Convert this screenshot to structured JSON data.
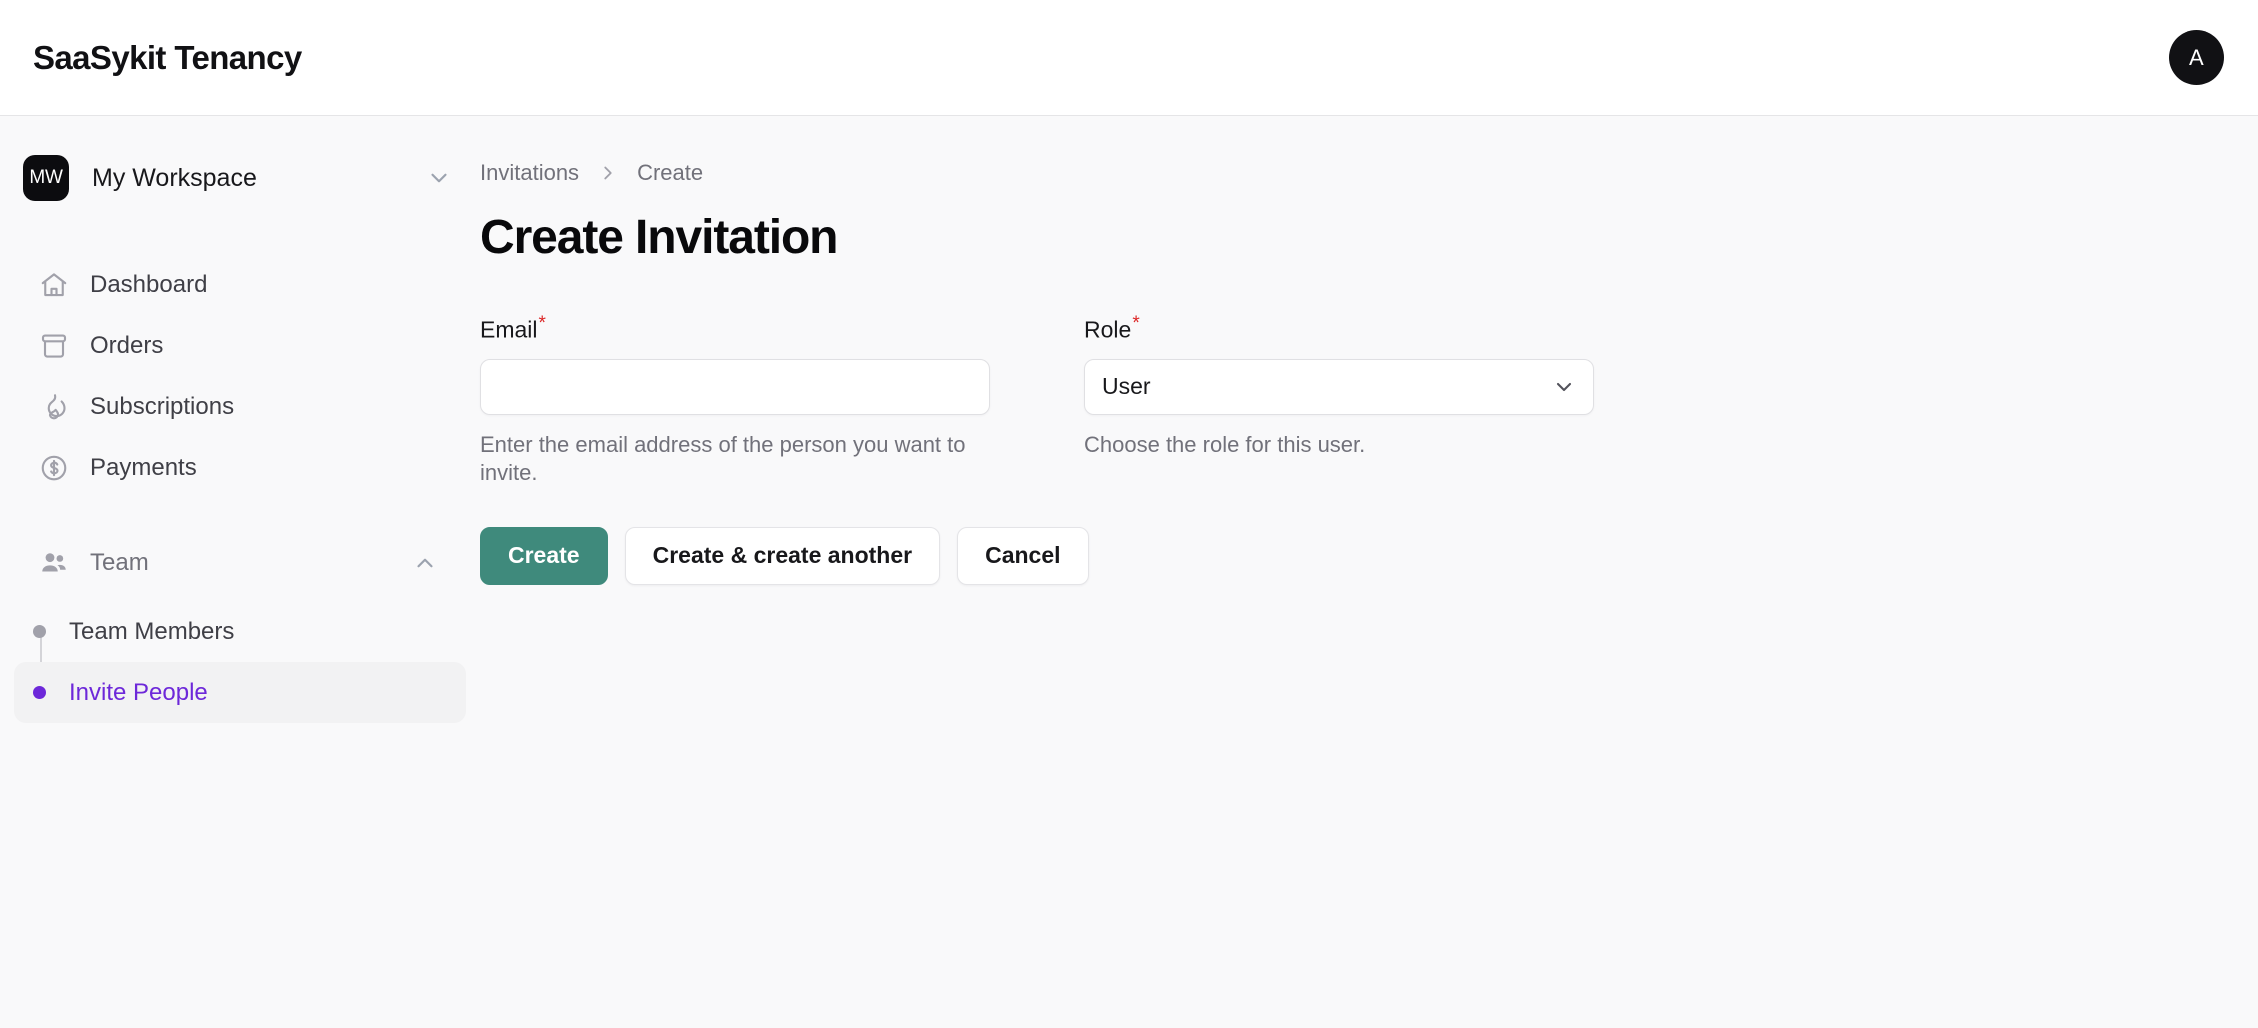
{
  "header": {
    "brand": "SaaSykit Tenancy",
    "avatar_initial": "A"
  },
  "sidebar": {
    "workspace": {
      "badge": "MW",
      "name": "My Workspace",
      "chevron": "chevron-down"
    },
    "items": [
      {
        "label": "Dashboard",
        "icon": "home-icon"
      },
      {
        "label": "Orders",
        "icon": "archive-box-icon"
      },
      {
        "label": "Subscriptions",
        "icon": "fire-icon"
      },
      {
        "label": "Payments",
        "icon": "currency-dollar-icon"
      }
    ],
    "group": {
      "label": "Team",
      "icon": "users-icon",
      "chevron": "chevron-up",
      "expanded": true,
      "children": [
        {
          "label": "Team Members",
          "active": false
        },
        {
          "label": "Invite People",
          "active": true
        }
      ]
    },
    "active_color": "#6d28d9"
  },
  "main": {
    "breadcrumb": {
      "parent": "Invitations",
      "separator": "chevron-right-icon",
      "current": "Create"
    },
    "title": "Create Invitation",
    "fields": {
      "email": {
        "label": "Email",
        "required_mark": "*",
        "value": "",
        "placeholder": "",
        "hint": "Enter the email address of the person you want to invite."
      },
      "role": {
        "label": "Role",
        "required_mark": "*",
        "value": "User",
        "options": [
          "User"
        ],
        "hint": "Choose the role for this user."
      }
    },
    "actions": {
      "primary": "Create",
      "secondary": "Create & create another",
      "cancel": "Cancel"
    }
  },
  "colors": {
    "primary_button": "#3f8a7c",
    "accent": "#6d28d9",
    "required": "#dc2626",
    "page_bg": "#f9f9fa",
    "header_bg": "#ffffff"
  }
}
